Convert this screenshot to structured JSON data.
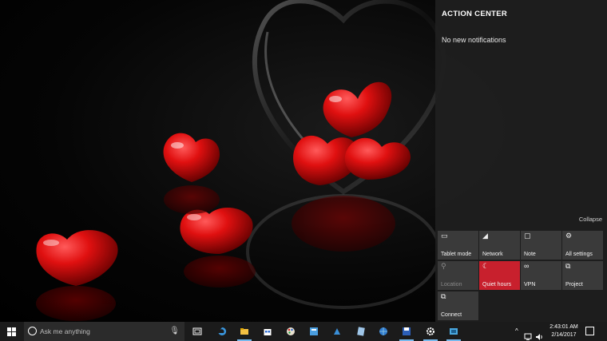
{
  "action_center": {
    "title": "ACTION CENTER",
    "empty_message": "No new notifications",
    "collapse_label": "Collapse",
    "quick_actions": [
      {
        "label": "Tablet mode",
        "icon": "tablet-icon",
        "state": "off"
      },
      {
        "label": "Network",
        "icon": "network-icon",
        "state": "off"
      },
      {
        "label": "Note",
        "icon": "note-icon",
        "state": "off"
      },
      {
        "label": "All settings",
        "icon": "gear-icon",
        "state": "off"
      },
      {
        "label": "Location",
        "icon": "location-icon",
        "state": "disabled"
      },
      {
        "label": "Quiet hours",
        "icon": "moon-icon",
        "state": "on"
      },
      {
        "label": "VPN",
        "icon": "vpn-icon",
        "state": "off"
      },
      {
        "label": "Project",
        "icon": "project-icon",
        "state": "off"
      },
      {
        "label": "Connect",
        "icon": "connect-icon",
        "state": "off"
      }
    ]
  },
  "taskbar": {
    "search_placeholder": "Ask me anything",
    "clock_time": "2:43:01 AM",
    "clock_date": "2/14/2017",
    "pinned_apps": [
      {
        "name": "task-view-icon"
      },
      {
        "name": "edge-icon"
      },
      {
        "name": "file-explorer-icon"
      },
      {
        "name": "store-icon"
      },
      {
        "name": "paint-icon"
      },
      {
        "name": "app-icon-1"
      },
      {
        "name": "app-icon-2"
      },
      {
        "name": "app-icon-3"
      },
      {
        "name": "internet-icon"
      },
      {
        "name": "save-icon"
      },
      {
        "name": "settings-icon"
      },
      {
        "name": "app-icon-4"
      }
    ]
  },
  "colors": {
    "accent_red": "#c8202d",
    "tile_bg": "#3a3a3a",
    "taskbar_bg": "#1b1b1b",
    "underline": "#76b9ed"
  }
}
